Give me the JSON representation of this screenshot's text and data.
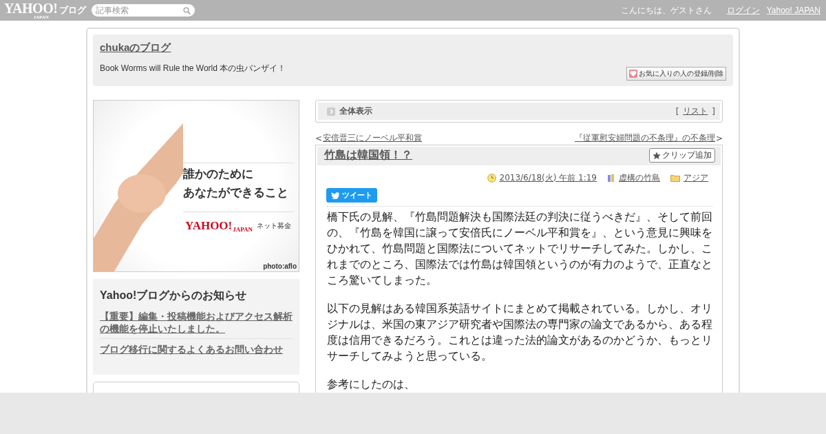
{
  "topbar": {
    "logo": "YAHOO!",
    "logo_sub": "JAPAN",
    "service": "ブログ",
    "search": {
      "placeholder": "記事検索"
    },
    "greeting": "こんにちは、ゲストさん",
    "links": [
      "ログイン",
      "Yahoo! JAPAN"
    ]
  },
  "blog": {
    "title": "chukaのブログ",
    "tagline": "Book Worms will Rule the World 本の虫バンザイ！",
    "favorite_button": "お気に入りの人の登録/削除"
  },
  "banner": {
    "lines": [
      "誰かのために",
      "あなたができること"
    ],
    "brand": "YAHOO!",
    "brand_sub": "JAPAN",
    "brand_label": "ネット募金",
    "credit": "photo:aflo"
  },
  "notice": {
    "title": "Yahoo!ブログからのお知らせ",
    "links": [
      "【重要】編集・投稿機能およびアクセス解析の機能を停止いたしました。",
      "ブログ移行に関するよくあるお問い合わせ"
    ]
  },
  "view_bar": {
    "label": "全体表示",
    "open_bracket": "[",
    "list_link": "リスト",
    "close_bracket": "]"
  },
  "nav": {
    "prev_mark": "<",
    "prev": "安倍晋三にノーベル平和賞",
    "next": "『従軍慰安婦問題の不条理』の不条理",
    "next_mark": ">"
  },
  "article": {
    "title": "竹島は韓国領！？",
    "clip_button": "クリップ追加",
    "date": "2013/6/18(火) 午前 1:19",
    "book": "虚構の竹島",
    "category": "アジア",
    "tweet": "ツイート",
    "paragraphs": [
      "橋下氏の見解、『竹島問題解決も国際法廷の判決に従うべきだ』、そして前回の、『竹島を韓国に譲って安倍氏にノーベル平和賞を』、という意見に興味をひかれて、竹島問題と国際法についてネットでリサーチしてみた。しかし、これまでのところ、国際法では竹島は韓国領というのが有力のようで、正直なところ驚いてしまった。",
      "以下の見解はある韓国系英語サイトにまとめて掲載されている。しかし、オリジナルは、米国の東アジア研究者や国際法の専門家の論文であるから、ある程度は信用できるだろう。これとは違った法的論文があるのかどうか、もっとリサーチしてみようと思っている。",
      "参考にしたのは、"
    ]
  }
}
